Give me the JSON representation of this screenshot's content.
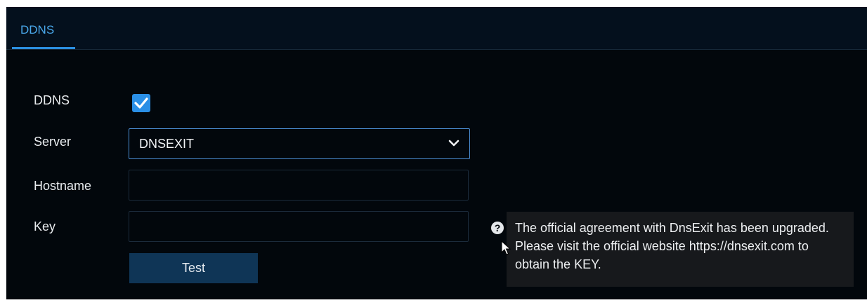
{
  "tabs": [
    {
      "label": "DDNS",
      "active": true
    }
  ],
  "form": {
    "ddns_label": "DDNS",
    "ddns_checked": true,
    "server_label": "Server",
    "server_value": "DNSEXIT",
    "hostname_label": "Hostname",
    "hostname_value": "",
    "key_label": "Key",
    "key_value": "",
    "test_button": "Test"
  },
  "tooltip": {
    "text": "The official agreement with DnsExit has been upgraded. Please visit the official website https://dnsexit.com to obtain the KEY."
  },
  "icons": {
    "checkbox": "checkmark-icon",
    "dropdown": "chevron-down-icon",
    "help": "question-circle-icon",
    "cursor": "mouse-cursor-icon"
  },
  "colors": {
    "accent": "#2a8fe6",
    "panel_background": "#02070c",
    "button_background": "#0f3556",
    "tooltip_background": "#17191c"
  }
}
